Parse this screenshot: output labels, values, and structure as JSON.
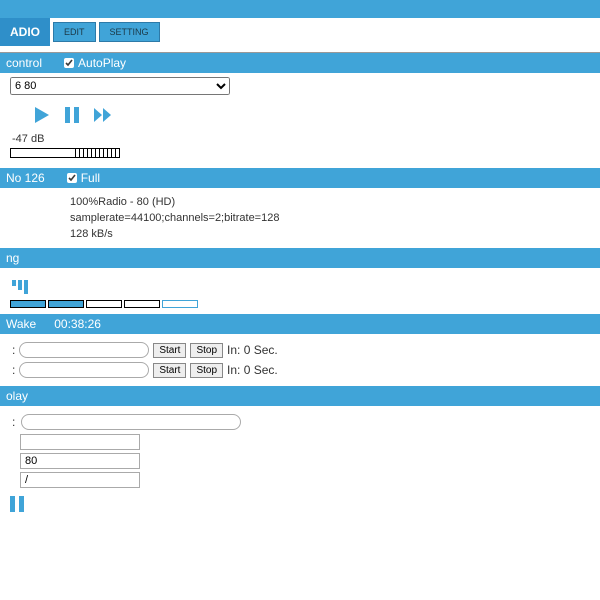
{
  "tabs": {
    "radio": "ADIO",
    "edit": "EDIT",
    "setting": "SETTING"
  },
  "control": {
    "title": "control",
    "autoplay_label": "AutoPlay",
    "station_selected": "6 80",
    "db": "-47 dB"
  },
  "stream": {
    "no_label": "No 126",
    "full_label": "Full",
    "line1": "100%Radio - 80 (HD)",
    "line2": "samplerate=44100;channels=2;bitrate=128",
    "line3": "128 kB/s"
  },
  "ng": {
    "title": "ng"
  },
  "wake": {
    "title": "Wake",
    "time": "00:38:26",
    "start": "Start",
    "stop": "Stop",
    "in1": "In: 0 Sec.",
    "in2": "In: 0 Sec."
  },
  "play": {
    "title": "olay"
  },
  "inputs": {
    "v1": "80",
    "v2": "/"
  }
}
